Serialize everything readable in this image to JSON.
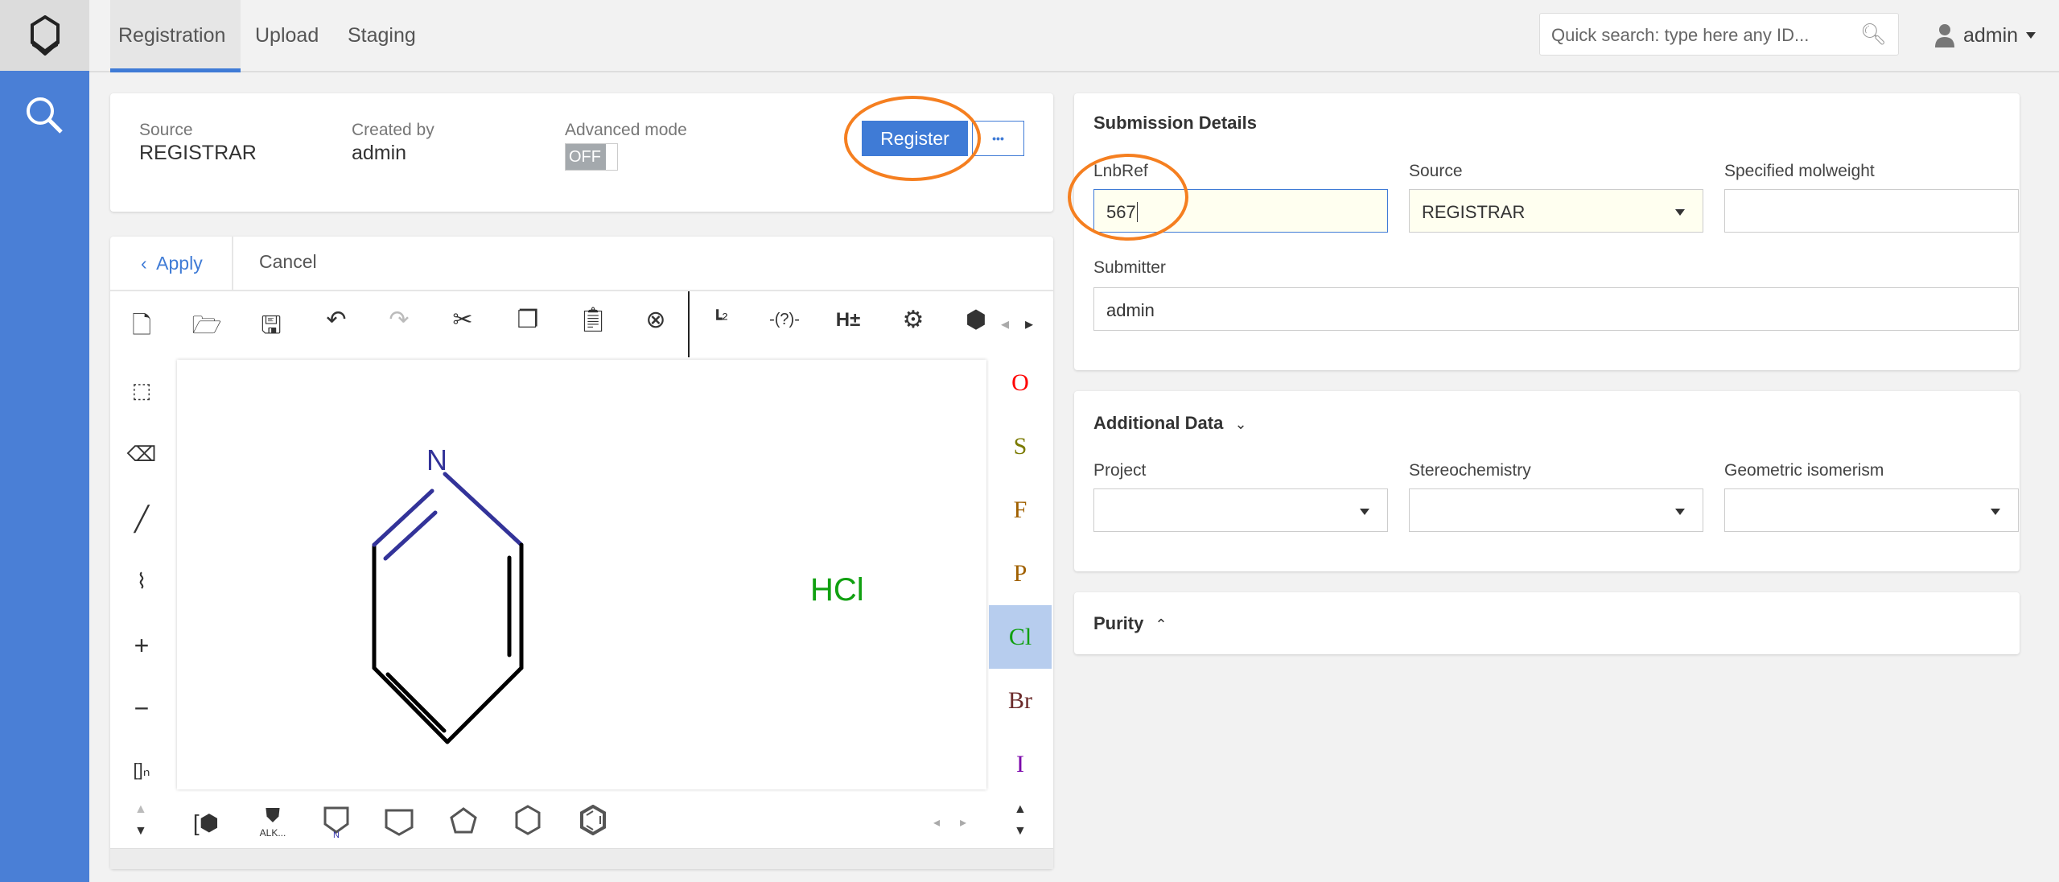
{
  "nav": {
    "tabs": [
      "Registration",
      "Upload",
      "Staging"
    ],
    "active": "Registration"
  },
  "search": {
    "placeholder": "Quick search: type here any ID..."
  },
  "user": {
    "name": "admin"
  },
  "summary": {
    "source_label": "Source",
    "source_value": "REGISTRAR",
    "created_label": "Created by",
    "created_value": "admin",
    "advanced_label": "Advanced mode",
    "advanced_state": "OFF",
    "register_label": "Register",
    "more_label": "•••"
  },
  "editor": {
    "apply_label": "Apply",
    "cancel_label": "Cancel",
    "toolbar": [
      "new-file",
      "open",
      "save",
      "undo",
      "redo",
      "cut",
      "copy",
      "paste",
      "zoom-reset",
      "clean-2d",
      "query-atom",
      "add-hydrogens",
      "settings",
      "info"
    ],
    "left_tools": [
      "select",
      "erase",
      "single-bond",
      "chain",
      "charge-plus",
      "charge-minus",
      "sgroup"
    ],
    "elements": [
      {
        "symbol": "O",
        "color": "#ff0000"
      },
      {
        "symbol": "S",
        "color": "#7a7a00"
      },
      {
        "symbol": "F",
        "color": "#a06000"
      },
      {
        "symbol": "P",
        "color": "#a06000"
      },
      {
        "symbol": "Cl",
        "color": "#10a010"
      },
      {
        "symbol": "Br",
        "color": "#6b2a2a"
      },
      {
        "symbol": "I",
        "color": "#7a00aa"
      }
    ],
    "selected_element": "Cl",
    "bottom_tools": [
      "template-lib",
      "ALK...",
      "pyrrolidine",
      "cyclobutane",
      "cyclopentane",
      "cyclohexane",
      "benzene"
    ],
    "molecule": {
      "atom": "N",
      "salt": "HCl"
    }
  },
  "submission": {
    "title": "Submission Details",
    "lnbref_label": "LnbRef",
    "lnbref_value": "567",
    "source_label": "Source",
    "source_value": "REGISTRAR",
    "molweight_label": "Specified molweight",
    "molweight_value": "",
    "submitter_label": "Submitter",
    "submitter_value": "admin"
  },
  "additional": {
    "title": "Additional Data",
    "project_label": "Project",
    "stereo_label": "Stereochemistry",
    "geo_label": "Geometric isomerism"
  },
  "purity": {
    "title": "Purity"
  },
  "colors": {
    "accent": "#3f7bd6",
    "sidebar": "#4a7fd6",
    "highlight": "#f57f20"
  }
}
